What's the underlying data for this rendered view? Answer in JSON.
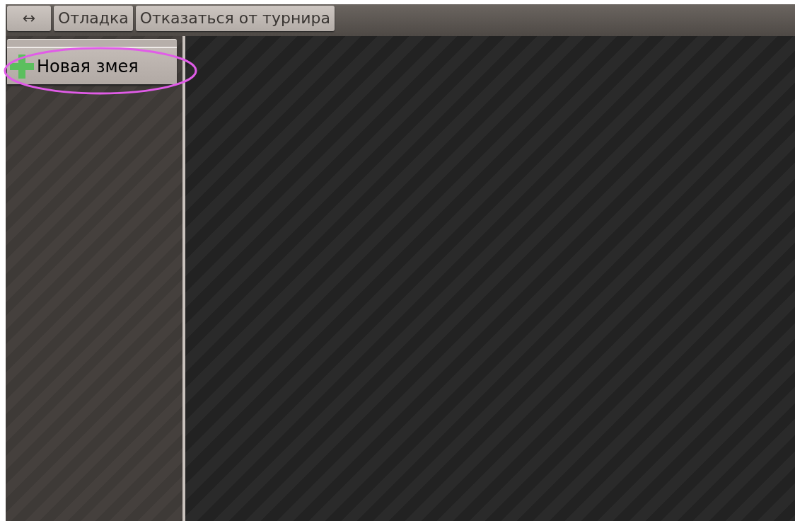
{
  "toolbar": {
    "buttons": [
      {
        "label": "↔"
      },
      {
        "label": "Отладка"
      },
      {
        "label": "Отказаться от турнира"
      }
    ]
  },
  "sidebar": {
    "new_button": {
      "label": "Новая змея"
    },
    "highlighted": true
  }
}
